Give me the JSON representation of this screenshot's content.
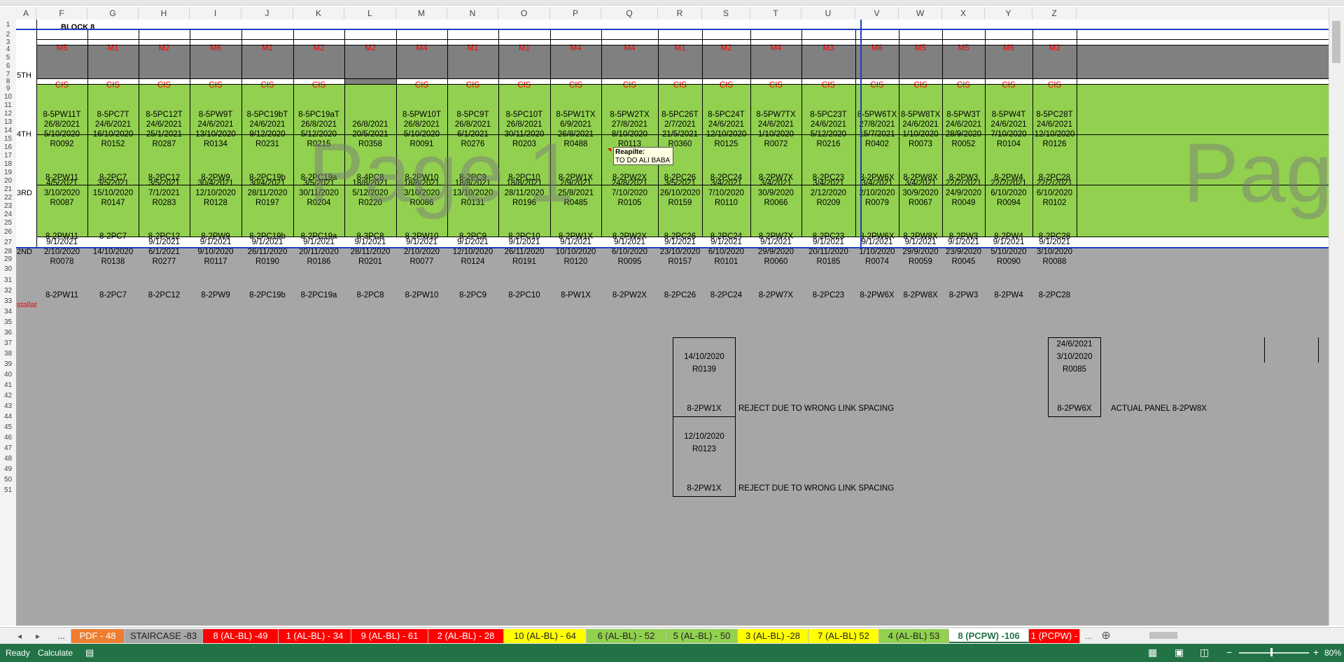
{
  "columns": [
    "A",
    "F",
    "G",
    "H",
    "I",
    "J",
    "K",
    "L",
    "M",
    "N",
    "O",
    "P",
    "Q",
    "R",
    "S",
    "T",
    "U",
    "V",
    "W",
    "X",
    "Y",
    "Z"
  ],
  "rows": [
    "1",
    "2",
    "3",
    "4",
    "5",
    "6",
    "7",
    "8",
    "9",
    "10",
    "11",
    "12",
    "13",
    "14",
    "15",
    "16",
    "17",
    "18",
    "19",
    "20",
    "21",
    "22",
    "23",
    "24",
    "25",
    "26",
    "27",
    "28",
    "29",
    "30",
    "31",
    "32",
    "33",
    "34",
    "35",
    "36",
    "37",
    "38",
    "39",
    "40",
    "41",
    "42",
    "43",
    "44",
    "45",
    "46",
    "47",
    "48",
    "49",
    "50",
    "51"
  ],
  "block_title": "BLOCK 8",
  "floor_labels": {
    "f5": "5TH",
    "f4": "4TH",
    "f3": "3RD",
    "f2": "2ND"
  },
  "installation_label": "stallat",
  "mold_row": [
    "M5",
    "M1",
    "M2",
    "M6",
    "M1",
    "M2",
    "M2",
    "M4",
    "M1",
    "M1",
    "M4",
    "M4",
    "M1",
    "M2",
    "M4",
    "M3",
    "M6",
    "M5",
    "M5",
    "M6",
    "M3"
  ],
  "cis_row": [
    "CIS",
    "CIS",
    "CIS",
    "CIS",
    "CIS",
    "CIS",
    "",
    "CIS",
    "CIS",
    "CIS",
    "CIS",
    "CIS",
    "CIS",
    "CIS",
    "CIS",
    "CIS",
    "CIS",
    "CIS",
    "CIS",
    "CIS",
    "CIS"
  ],
  "fifth_codes": [
    "8-5PW11T",
    "8-5PC7T",
    "8-5PC12T",
    "8-5PW9T",
    "8-5PC19bT",
    "8-5PC19aT",
    "",
    "8-5PW10T",
    "8-5PC9T",
    "8-5PC10T",
    "8-5PW1TX",
    "8-5PW2TX",
    "8-5PC26T",
    "8-5PC24T",
    "8-5PW7TX",
    "8-5PC23T",
    "8-5PW6TX",
    "8-5PW8TX",
    "8-5PW3T",
    "8-5PW4T",
    "8-5PC28T"
  ],
  "fourth": [
    {
      "d1": "26/8/2021",
      "d2": "5/10/2020",
      "r": "R0092",
      "code": "8-2PW11"
    },
    {
      "d1": "24/6/2021",
      "d2": "16/10/2020",
      "r": "R0152",
      "code": "8-2PC7"
    },
    {
      "d1": "24/6/2021",
      "d2": "25/1/2021",
      "r": "R0287",
      "code": "8-2PC12"
    },
    {
      "d1": "24/6/2021",
      "d2": "13/10/2020",
      "r": "R0134",
      "code": "8-2PW9"
    },
    {
      "d1": "24/6/2021",
      "d2": "9/12/2020",
      "r": "R0231",
      "code": "8-2PC19b"
    },
    {
      "d1": "26/8/2021",
      "d2": "5/12/2020",
      "r": "R0215",
      "code": "8-2PC19a"
    },
    {
      "d1": "26/8/2021",
      "d2": "20/5/2021",
      "r": "R0358",
      "code": "8-4PC8"
    },
    {
      "d1": "26/8/2021",
      "d2": "5/10/2020",
      "r": "R0091",
      "code": "8-2PW10"
    },
    {
      "d1": "26/8/2021",
      "d2": "6/1/2021",
      "r": "R0276",
      "code": "8-2PC9"
    },
    {
      "d1": "26/8/2021",
      "d2": "30/11/2020",
      "r": "R0203",
      "code": "8-2PC10"
    },
    {
      "d1": "6/9/2021",
      "d2": "26/8/2021",
      "r": "R0488",
      "code": "8-2PW1X"
    },
    {
      "d1": "27/8/2021",
      "d2": "8/10/2020",
      "r": "R0113",
      "code": "8-2PW2X"
    },
    {
      "d1": "2/7/2021",
      "d2": "21/5/2021",
      "r": "R0360",
      "code": "8-2PC26"
    },
    {
      "d1": "24/6/2021",
      "d2": "12/10/2020",
      "r": "R0125",
      "code": "8-2PC24"
    },
    {
      "d1": "24/6/2021",
      "d2": "1/10/2020",
      "r": "R0072",
      "code": "8-2PW7X"
    },
    {
      "d1": "24/6/2021",
      "d2": "5/12/2020",
      "r": "R0216",
      "code": "8-2PC23"
    },
    {
      "d1": "27/8/2021",
      "d2": "15/7/2021",
      "r": "R0402",
      "code": "8-2PW6X"
    },
    {
      "d1": "24/6/2021",
      "d2": "1/10/2020",
      "r": "R0073",
      "code": "8-2PW8X"
    },
    {
      "d1": "24/6/2021",
      "d2": "28/9/2020",
      "r": "R0052",
      "code": "8-2PW3"
    },
    {
      "d1": "24/6/2021",
      "d2": "7/10/2020",
      "r": "R0104",
      "code": "8-2PW4"
    },
    {
      "d1": "24/6/2021",
      "d2": "12/10/2020",
      "r": "R0126",
      "code": "8-2PC28"
    }
  ],
  "third": [
    {
      "d1": "4/5/2021",
      "d2": "3/10/2020",
      "r": "R0087",
      "code": "8-2PW11"
    },
    {
      "d1": "3/5/2021",
      "d2": "15/10/2020",
      "r": "R0147",
      "code": "8-2PC7"
    },
    {
      "d1": "3/5/2021",
      "d2": "7/1/2021",
      "r": "R0283",
      "code": "8-2PC12"
    },
    {
      "d1": "30/4/2021",
      "d2": "12/10/2020",
      "r": "R0128",
      "code": "8-2PW9"
    },
    {
      "d1": "30/4/2021",
      "d2": "28/11/2020",
      "r": "R0197",
      "code": "8-2PC19b"
    },
    {
      "d1": "3/5/2021",
      "d2": "30/11/2020",
      "r": "R0204",
      "code": "8-2PC19a"
    },
    {
      "d1": "18/8/2021",
      "d2": "5/12/2020",
      "r": "R0220",
      "code": "8-3PC8"
    },
    {
      "d1": "18/8/2021",
      "d2": "3/10/2020",
      "r": "R0086",
      "code": "8-2PW10"
    },
    {
      "d1": "18/8/2021",
      "d2": "13/10/2020",
      "r": "R0131",
      "code": "8-2PC9"
    },
    {
      "d1": "18/8/2021",
      "d2": "28/11/2020",
      "r": "R0196",
      "code": "8-2PC10"
    },
    {
      "d1": "2/9/2021",
      "d2": "25/8/2021",
      "r": "R0485",
      "code": "8-2PW1X"
    },
    {
      "d1": "24/8/2021",
      "d2": "7/10/2020",
      "r": "R0105",
      "code": "8-2PW2X"
    },
    {
      "d1": "3/5/2021",
      "d2": "26/10/2020",
      "r": "R0159",
      "code": "8-2PC26"
    },
    {
      "d1": "3/4/2021",
      "d2": "7/10/2020",
      "r": "R0110",
      "code": "8-2PC24"
    },
    {
      "d1": "3/4/2021",
      "d2": "30/9/2020",
      "r": "R0066",
      "code": "8-2PW7X"
    },
    {
      "d1": "3/4/2021",
      "d2": "2/12/2020",
      "r": "R0209",
      "code": "8-2PC23"
    },
    {
      "d1": "3/4/2021",
      "d2": "2/10/2020",
      "r": "R0079",
      "code": "8-2PW6X"
    },
    {
      "d1": "3/4/2021",
      "d2": "30/9/2020",
      "r": "R0067",
      "code": "8-2PW8X"
    },
    {
      "d1": "22/2/2021",
      "d2": "24/9/2020",
      "r": "R0049",
      "code": "8-2PW3"
    },
    {
      "d1": "22/2/2021",
      "d2": "6/10/2020",
      "r": "R0094",
      "code": "8-2PW4"
    },
    {
      "d1": "22/2/2021",
      "d2": "6/10/2020",
      "r": "R0102",
      "code": "8-2PC28"
    }
  ],
  "second": [
    {
      "d1": "9/1/2021",
      "d2": "2/10/2020",
      "r": "R0078",
      "code": "8-2PW11"
    },
    {
      "d1": "",
      "d2": "14/10/2020",
      "r": "R0138",
      "code": "8-2PC7"
    },
    {
      "d1": "9/1/2021",
      "d2": "6/1/2021",
      "r": "R0277",
      "code": "8-2PC12"
    },
    {
      "d1": "9/1/2021",
      "d2": "9/10/2020",
      "r": "R0117",
      "code": "8-2PW9"
    },
    {
      "d1": "9/1/2021",
      "d2": "26/11/2020",
      "r": "R0190",
      "code": "8-2PC19b"
    },
    {
      "d1": "9/1/2021",
      "d2": "20/11/2020",
      "r": "R0186",
      "code": "8-2PC19a"
    },
    {
      "d1": "9/1/2021",
      "d2": "28/11/2020",
      "r": "R0201",
      "code": "8-2PC8"
    },
    {
      "d1": "9/1/2021",
      "d2": "2/10/2020",
      "r": "R0077",
      "code": "8-2PW10"
    },
    {
      "d1": "9/1/2021",
      "d2": "12/10/2020",
      "r": "R0124",
      "code": "8-2PC9"
    },
    {
      "d1": "9/1/2021",
      "d2": "26/11/2020",
      "r": "R0191",
      "code": "8-2PC10"
    },
    {
      "d1": "9/1/2021",
      "d2": "10/10/2020",
      "r": "R0120",
      "code": "8-PW1X"
    },
    {
      "d1": "9/1/2021",
      "d2": "6/10/2020",
      "r": "R0095",
      "code": "8-2PW2X"
    },
    {
      "d1": "9/1/2021",
      "d2": "23/10/2020",
      "r": "R0157",
      "code": "8-2PC26"
    },
    {
      "d1": "9/1/2021",
      "d2": "6/10/2020",
      "r": "R0101",
      "code": "8-2PC24"
    },
    {
      "d1": "9/1/2021",
      "d2": "29/9/2020",
      "r": "R0060",
      "code": "8-2PW7X"
    },
    {
      "d1": "9/1/2021",
      "d2": "20/11/2020",
      "r": "R0185",
      "code": "8-2PC23"
    },
    {
      "d1": "9/1/2021",
      "d2": "1/10/2020",
      "r": "R0074",
      "code": "8-2PW6X"
    },
    {
      "d1": "9/1/2021",
      "d2": "29/9/2020",
      "r": "R0059",
      "code": "8-2PW8X"
    },
    {
      "d1": "9/1/2021",
      "d2": "23/9/2020",
      "r": "R0045",
      "code": "8-2PW3"
    },
    {
      "d1": "9/1/2021",
      "d2": "5/10/2020",
      "r": "R0090",
      "code": "8-2PW4"
    },
    {
      "d1": "9/1/2021",
      "d2": "3/10/2020",
      "r": "R0088",
      "code": "8-2PC28"
    }
  ],
  "comment": {
    "author": "Reapilte:",
    "text": "TO DO ALI BABA"
  },
  "rejects": [
    {
      "d": "14/10/2020",
      "r": "R0139",
      "code": "8-2PW1X",
      "note": "REJECT DUE TO WRONG LINK SPACING"
    },
    {
      "d": "12/10/2020",
      "r": "R0123",
      "code": "8-2PW1X",
      "note": "REJECT DUE TO WRONG LINK SPACING"
    }
  ],
  "actual_panel": {
    "d1": "24/6/2021",
    "d2": "3/10/2020",
    "r": "R0085",
    "code": "8-2PW6X",
    "note": "ACTUAL PANEL 8-2PW8X"
  },
  "watermarks": [
    "Page 1",
    "Page"
  ],
  "tabs": [
    {
      "label": "...",
      "bg": "#efefef",
      "fg": "#333"
    },
    {
      "label": "PDF - 48",
      "bg": "#ed7d31",
      "fg": "#ffffff"
    },
    {
      "label": "STAIRCASE -83",
      "bg": "#a6a6a6",
      "fg": "#222"
    },
    {
      "label": "8 (AL-BL) -49",
      "bg": "#ff0000",
      "fg": "#ffffff"
    },
    {
      "label": "1 (AL-BL) - 34",
      "bg": "#ff0000",
      "fg": "#ffffff"
    },
    {
      "label": "9 (AL-BL) - 61",
      "bg": "#ff0000",
      "fg": "#ffffff"
    },
    {
      "label": "2 (AL-BL) - 28",
      "bg": "#ff0000",
      "fg": "#ffffff"
    },
    {
      "label": "10 (AL-BL) - 64",
      "bg": "#ffff00",
      "fg": "#222"
    },
    {
      "label": "6 (AL-BL) - 52",
      "bg": "#92d050",
      "fg": "#222"
    },
    {
      "label": "5 (AL-BL) - 50",
      "bg": "#92d050",
      "fg": "#222"
    },
    {
      "label": "3 (AL-BL) -28",
      "bg": "#ffff00",
      "fg": "#222"
    },
    {
      "label": "7 (AL-BL) 52",
      "bg": "#ffff00",
      "fg": "#222"
    },
    {
      "label": "4 (AL-BL) 53",
      "bg": "#92d050",
      "fg": "#222"
    },
    {
      "label": "8 (PCPW) -106",
      "bg": "#ffffff",
      "fg": "#217346"
    },
    {
      "label": "1 (PCPW) -",
      "bg": "#ff0000",
      "fg": "#ffffff"
    }
  ],
  "tab_more": "...",
  "status": {
    "ready": "Ready",
    "calculate": "Calculate",
    "zoom": "80%"
  }
}
